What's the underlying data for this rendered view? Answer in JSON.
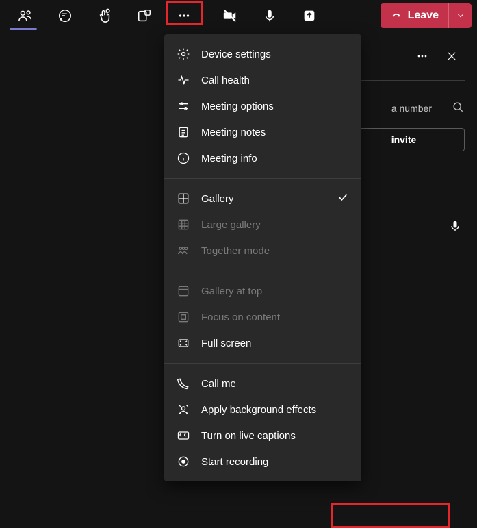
{
  "toolbar": {
    "leave_label": "Leave"
  },
  "panel": {
    "search_text": "a number",
    "invite_label": "invite"
  },
  "menu": {
    "sections": [
      [
        {
          "label": "Device settings",
          "disabled": false
        },
        {
          "label": "Call health",
          "disabled": false
        },
        {
          "label": "Meeting options",
          "disabled": false
        },
        {
          "label": "Meeting notes",
          "disabled": false
        },
        {
          "label": "Meeting info",
          "disabled": false
        }
      ],
      [
        {
          "label": "Gallery",
          "disabled": false,
          "checked": true
        },
        {
          "label": "Large gallery",
          "disabled": true
        },
        {
          "label": "Together mode",
          "disabled": true
        }
      ],
      [
        {
          "label": "Gallery at top",
          "disabled": true
        },
        {
          "label": "Focus on content",
          "disabled": true
        },
        {
          "label": "Full screen",
          "disabled": false
        }
      ],
      [
        {
          "label": "Call me",
          "disabled": false
        },
        {
          "label": "Apply background effects",
          "disabled": false
        },
        {
          "label": "Turn on live captions",
          "disabled": false
        },
        {
          "label": "Start recording",
          "disabled": false,
          "highlighted": true
        }
      ]
    ]
  }
}
